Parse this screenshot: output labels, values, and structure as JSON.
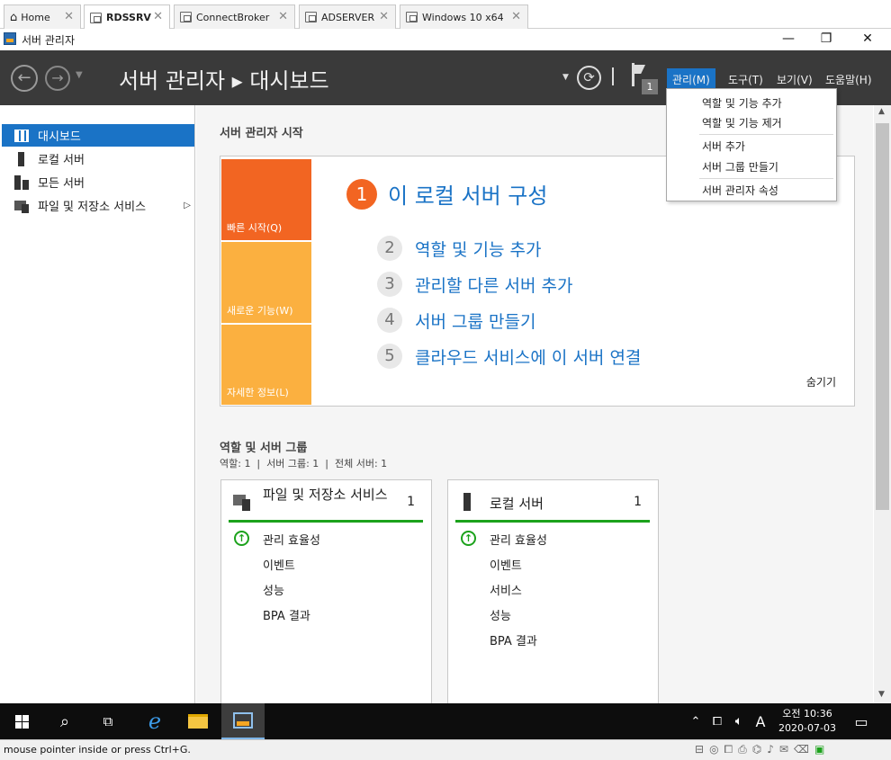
{
  "vm_tabs": [
    {
      "label": "Home",
      "icon": "home-icon"
    },
    {
      "label": "RDSSRV",
      "icon": "vm-icon",
      "active": true
    },
    {
      "label": "ConnectBroker",
      "icon": "vm-icon"
    },
    {
      "label": "ADSERVER",
      "icon": "vm-icon"
    },
    {
      "label": "Windows 10 x64",
      "icon": "vm-icon"
    }
  ],
  "window": {
    "title": "서버 관리자",
    "min": "—",
    "restore": "❐",
    "close": "✕"
  },
  "header": {
    "breadcrumb": "서버 관리자 ▸ 대시보드",
    "flag_count": "1",
    "menus": [
      "관리(M)",
      "도구(T)",
      "보기(V)",
      "도움말(H)"
    ]
  },
  "dropdown": {
    "items": [
      "역할 및 기능 추가",
      "역할 및 기능 제거",
      "서버 추가",
      "서버 그룹 만들기",
      "서버 관리자 속성"
    ]
  },
  "nav": {
    "items": [
      "대시보드",
      "로컬 서버",
      "모든 서버",
      "파일 및 저장소 서비스"
    ],
    "arrow": "▷"
  },
  "welcome": {
    "heading": "서버 관리자 시작",
    "tiles": [
      "빠른 시작(Q)",
      "새로운 기능(W)",
      "자세한 정보(L)"
    ],
    "main_step": {
      "num": "1",
      "text": "이 로컬 서버 구성"
    },
    "steps": [
      {
        "num": "2",
        "text": "역할 및 기능 추가"
      },
      {
        "num": "3",
        "text": "관리할 다른 서버 추가"
      },
      {
        "num": "4",
        "text": "서버 그룹 만들기"
      },
      {
        "num": "5",
        "text": "클라우드 서비스에 이 서버 연결"
      }
    ],
    "hide": "숨기기"
  },
  "groups": {
    "heading": "역할 및 서버 그룹",
    "summary": "역할: 1  |  서버 그룹: 1  |  전체 서버: 1",
    "cards": [
      {
        "title": "파일 및 저장소 서비스",
        "count": "1",
        "rows": [
          "관리 효율성",
          "이벤트",
          "성능",
          "BPA 결과"
        ]
      },
      {
        "title": "로컬 서버",
        "count": "1",
        "rows": [
          "관리 효율성",
          "이벤트",
          "서비스",
          "성능",
          "BPA 결과"
        ]
      }
    ]
  },
  "taskbar": {
    "ime": "A",
    "time": "오전 10:36",
    "date": "2020-07-03"
  },
  "status": {
    "text": "mouse pointer inside or press Ctrl+G."
  },
  "colors": {
    "accent": "#1a73c6",
    "header_bg": "#3a3a3a",
    "tile_orange": "#f26522",
    "tile_light": "#fbb040",
    "ok_green": "#1ca21c"
  }
}
